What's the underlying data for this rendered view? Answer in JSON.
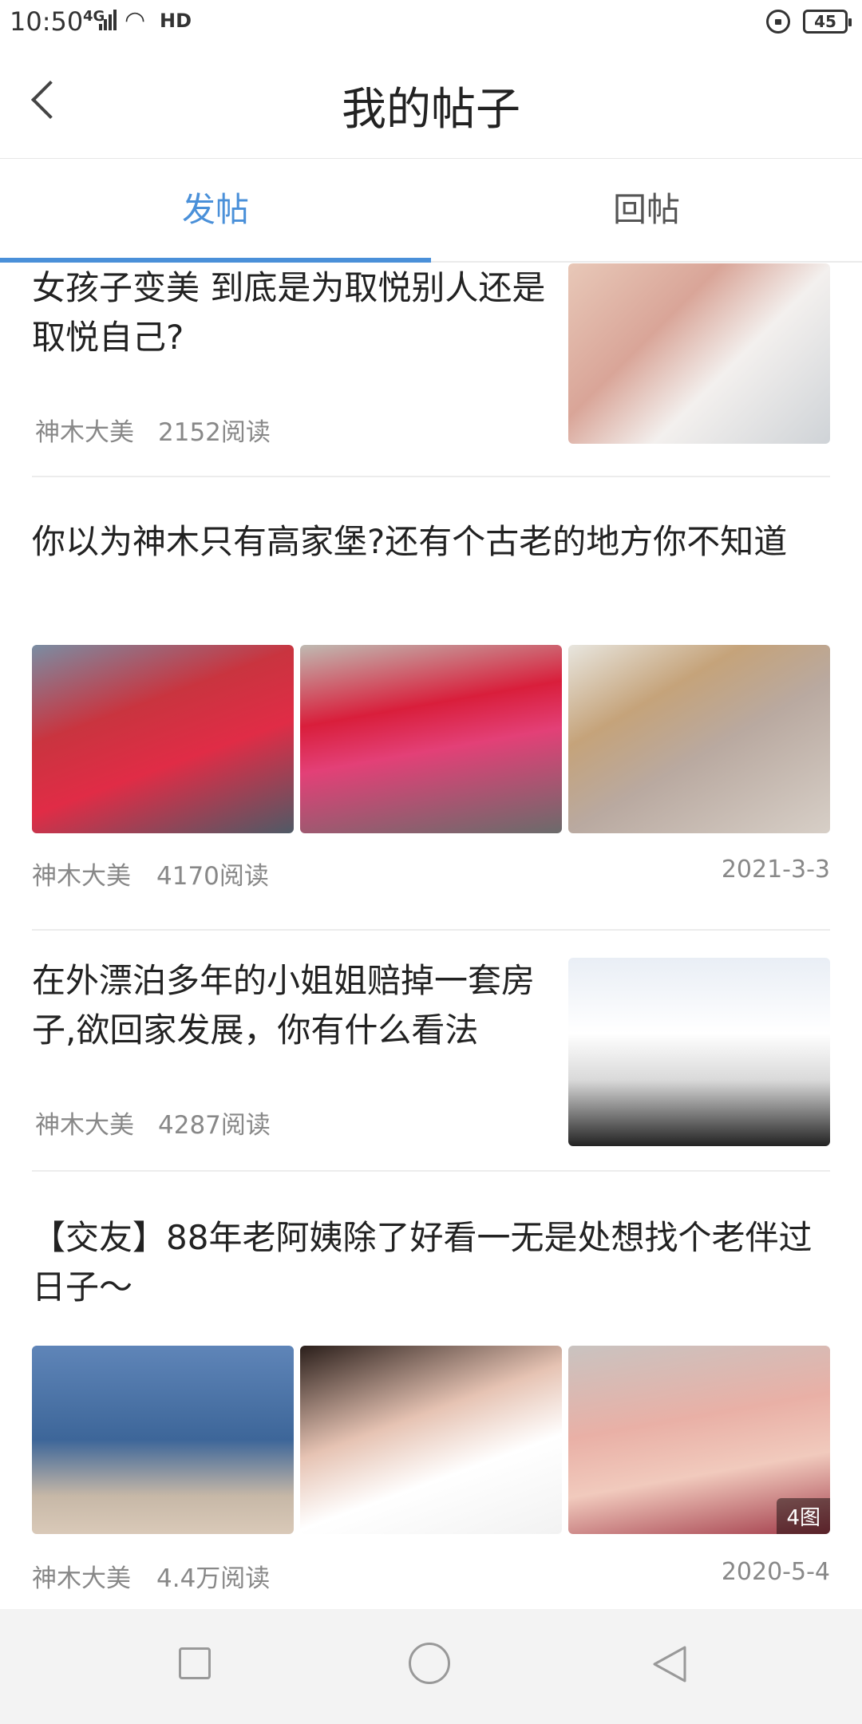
{
  "status_bar": {
    "time": "10:50",
    "signal": "4G",
    "hd": "HD",
    "battery": "45"
  },
  "header": {
    "title": "我的帖子"
  },
  "tabs": [
    {
      "label": "发帖",
      "active": true
    },
    {
      "label": "回帖",
      "active": false
    }
  ],
  "posts": [
    {
      "title": "女孩子变美 到底是为取悦别人还是取悦自己?",
      "author": "神木大美",
      "reads": "2152阅读"
    },
    {
      "title": "你以为神木只有高家堡?还有个古老的地方你不知道",
      "author": "神木大美",
      "reads": "4170阅读",
      "date": "2021-3-3"
    },
    {
      "title": "在外漂泊多年的小姐姐赔掉一套房子,欲回家发展，你有什么看法",
      "author": "神木大美",
      "reads": "4287阅读"
    },
    {
      "title": "【交友】88年老阿姨除了好看一无是处想找个老伴过日子～",
      "author": "神木大美",
      "reads": "4.4万阅读",
      "date": "2020-5-4",
      "image_count": "4图"
    }
  ],
  "colors": {
    "accent": "#4a90d9",
    "meta": "#888888"
  }
}
